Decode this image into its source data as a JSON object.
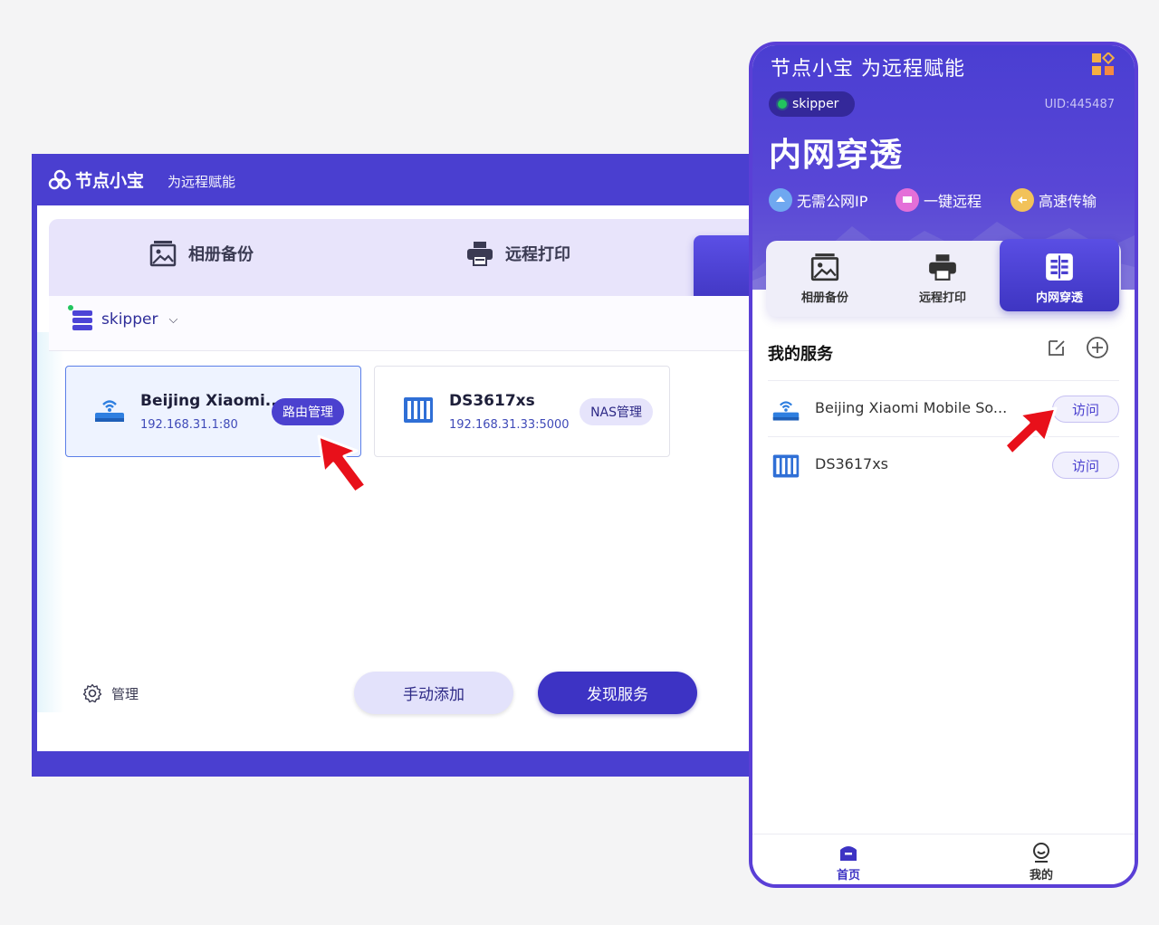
{
  "desktop": {
    "app_name": "节点小宝",
    "slogan": "为远程赋能",
    "tabs": [
      "相册备份",
      "远程打印"
    ],
    "device": "skipper",
    "services": [
      {
        "name": "Beijing Xiaomi...",
        "addr": "192.168.31.1:80",
        "action": "路由管理"
      },
      {
        "name": "DS3617xs",
        "addr": "192.168.31.33:5000",
        "action": "NAS管理"
      }
    ],
    "manage_label": "管理",
    "manual_add": "手动添加",
    "discover": "发现服务"
  },
  "phone": {
    "title": "节点小宝 为远程赋能",
    "device": "skipper",
    "uid": "UID:445487",
    "headline": "内网穿透",
    "features": [
      "无需公网IP",
      "一键远程",
      "高速传输"
    ],
    "tabs": [
      "相册备份",
      "远程打印",
      "内网穿透"
    ],
    "section_title": "我的服务",
    "services": [
      {
        "name": "Beijing Xiaomi Mobile So...",
        "action": "访问"
      },
      {
        "name": "DS3617xs",
        "action": "访问"
      }
    ],
    "nav": [
      "首页",
      "我的"
    ]
  },
  "colors": {
    "brand": "#4a3fd0",
    "accent": "#3d33c4",
    "online": "#22c55e",
    "arrow": "#e8101a"
  }
}
